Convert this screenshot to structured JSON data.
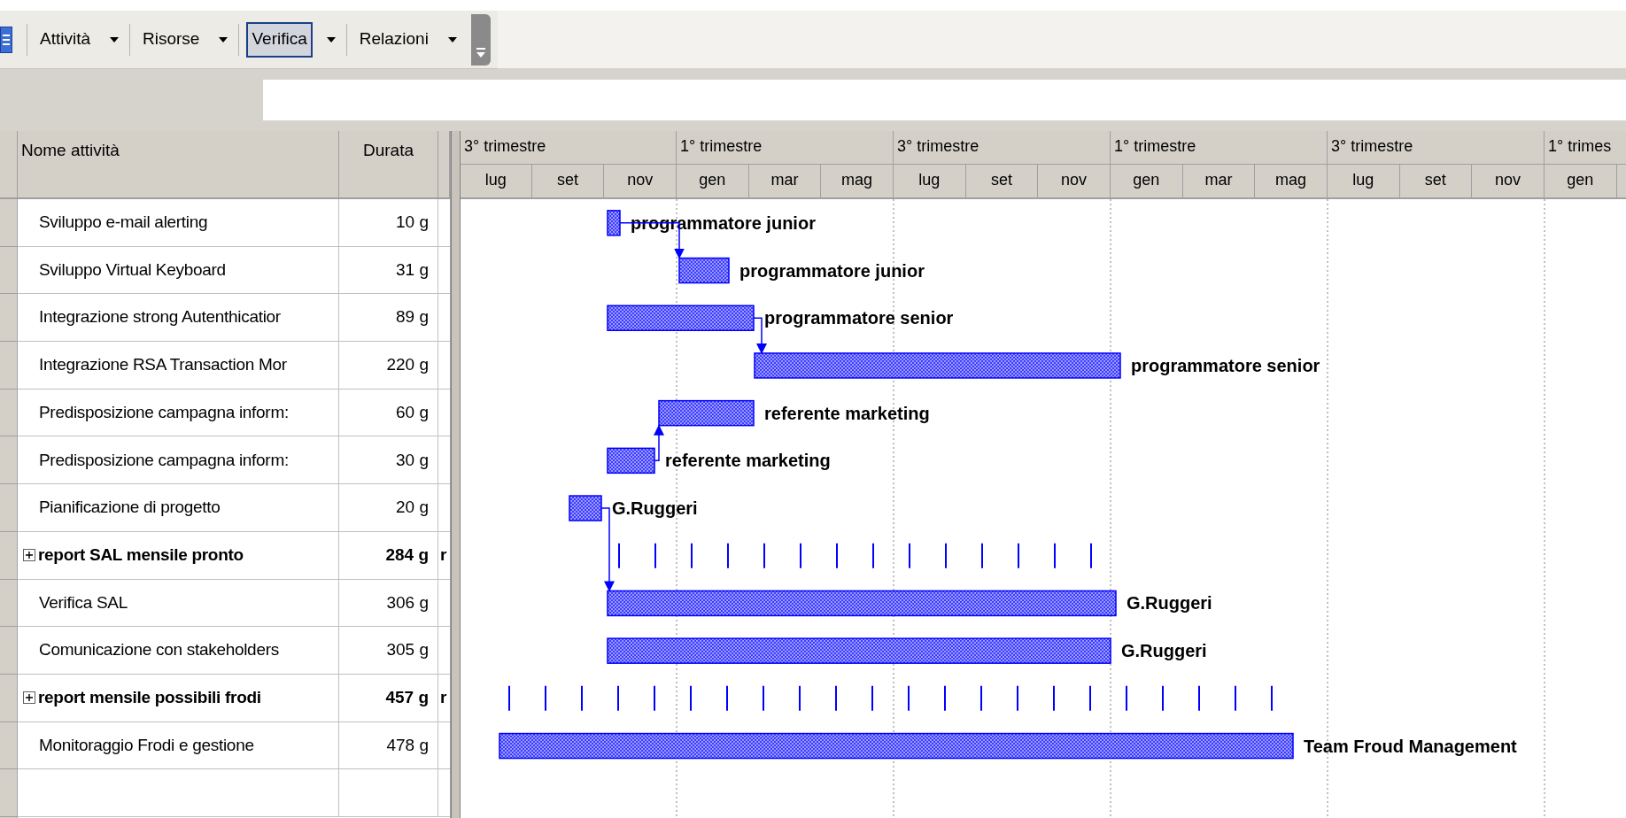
{
  "toolbar": {
    "items": [
      {
        "label": "Attività",
        "selected": false
      },
      {
        "label": "Risorse",
        "selected": false
      },
      {
        "label": "Verifica",
        "selected": true
      },
      {
        "label": "Relazioni",
        "selected": false
      }
    ]
  },
  "table": {
    "columns": [
      "Nome attività",
      "Durata"
    ],
    "rows": [
      {
        "kind": "task",
        "name": "Sviluppo e-mail alerting",
        "duration": "10 g",
        "resource": "programmatore junior"
      },
      {
        "kind": "task",
        "name": "Sviluppo Virtual Keyboard",
        "duration": "31 g",
        "resource": "programmatore junior"
      },
      {
        "kind": "task",
        "name": "Integrazione strong Autenthicatior",
        "duration": "89 g",
        "resource": "programmatore senior"
      },
      {
        "kind": "task",
        "name": "Integrazione RSA Transaction Mor",
        "duration": "220 g",
        "resource": "programmatore senior"
      },
      {
        "kind": "task",
        "name": "Predisposizione campagna inform:",
        "duration": "60 g",
        "resource": "referente marketing"
      },
      {
        "kind": "task",
        "name": "Predisposizione campagna inform:",
        "duration": "30 g",
        "resource": "referente marketing"
      },
      {
        "kind": "task",
        "name": "Pianificazione di progetto",
        "duration": "20 g",
        "resource": "G.Ruggeri"
      },
      {
        "kind": "summary",
        "expanded": false,
        "name": "report SAL mensile pronto",
        "duration": "284 g",
        "column_3": "r"
      },
      {
        "kind": "task",
        "name": "Verifica SAL",
        "duration": "306 g",
        "resource": "G.Ruggeri"
      },
      {
        "kind": "task",
        "name": "Comunicazione con stakeholders",
        "duration": "305 g",
        "resource": "G.Ruggeri"
      },
      {
        "kind": "summary",
        "expanded": false,
        "name": "report mensile possibili frodi",
        "duration": "457 g",
        "column_3": "r"
      },
      {
        "kind": "task",
        "name": "Monitoraggio Frodi e gestione",
        "duration": "478 g",
        "resource": "Team Froud Management"
      }
    ]
  },
  "timescale": {
    "quarters": [
      "3° trimestre",
      "1° trimestre",
      "3° trimestre",
      "1° trimestre",
      "3° trimestre",
      "1° trimes"
    ],
    "months": [
      "lug",
      "set",
      "nov",
      "gen",
      "mar",
      "mag",
      "lug",
      "set",
      "nov",
      "gen",
      "mar",
      "mag",
      "lug",
      "set",
      "nov",
      "gen"
    ]
  }
}
